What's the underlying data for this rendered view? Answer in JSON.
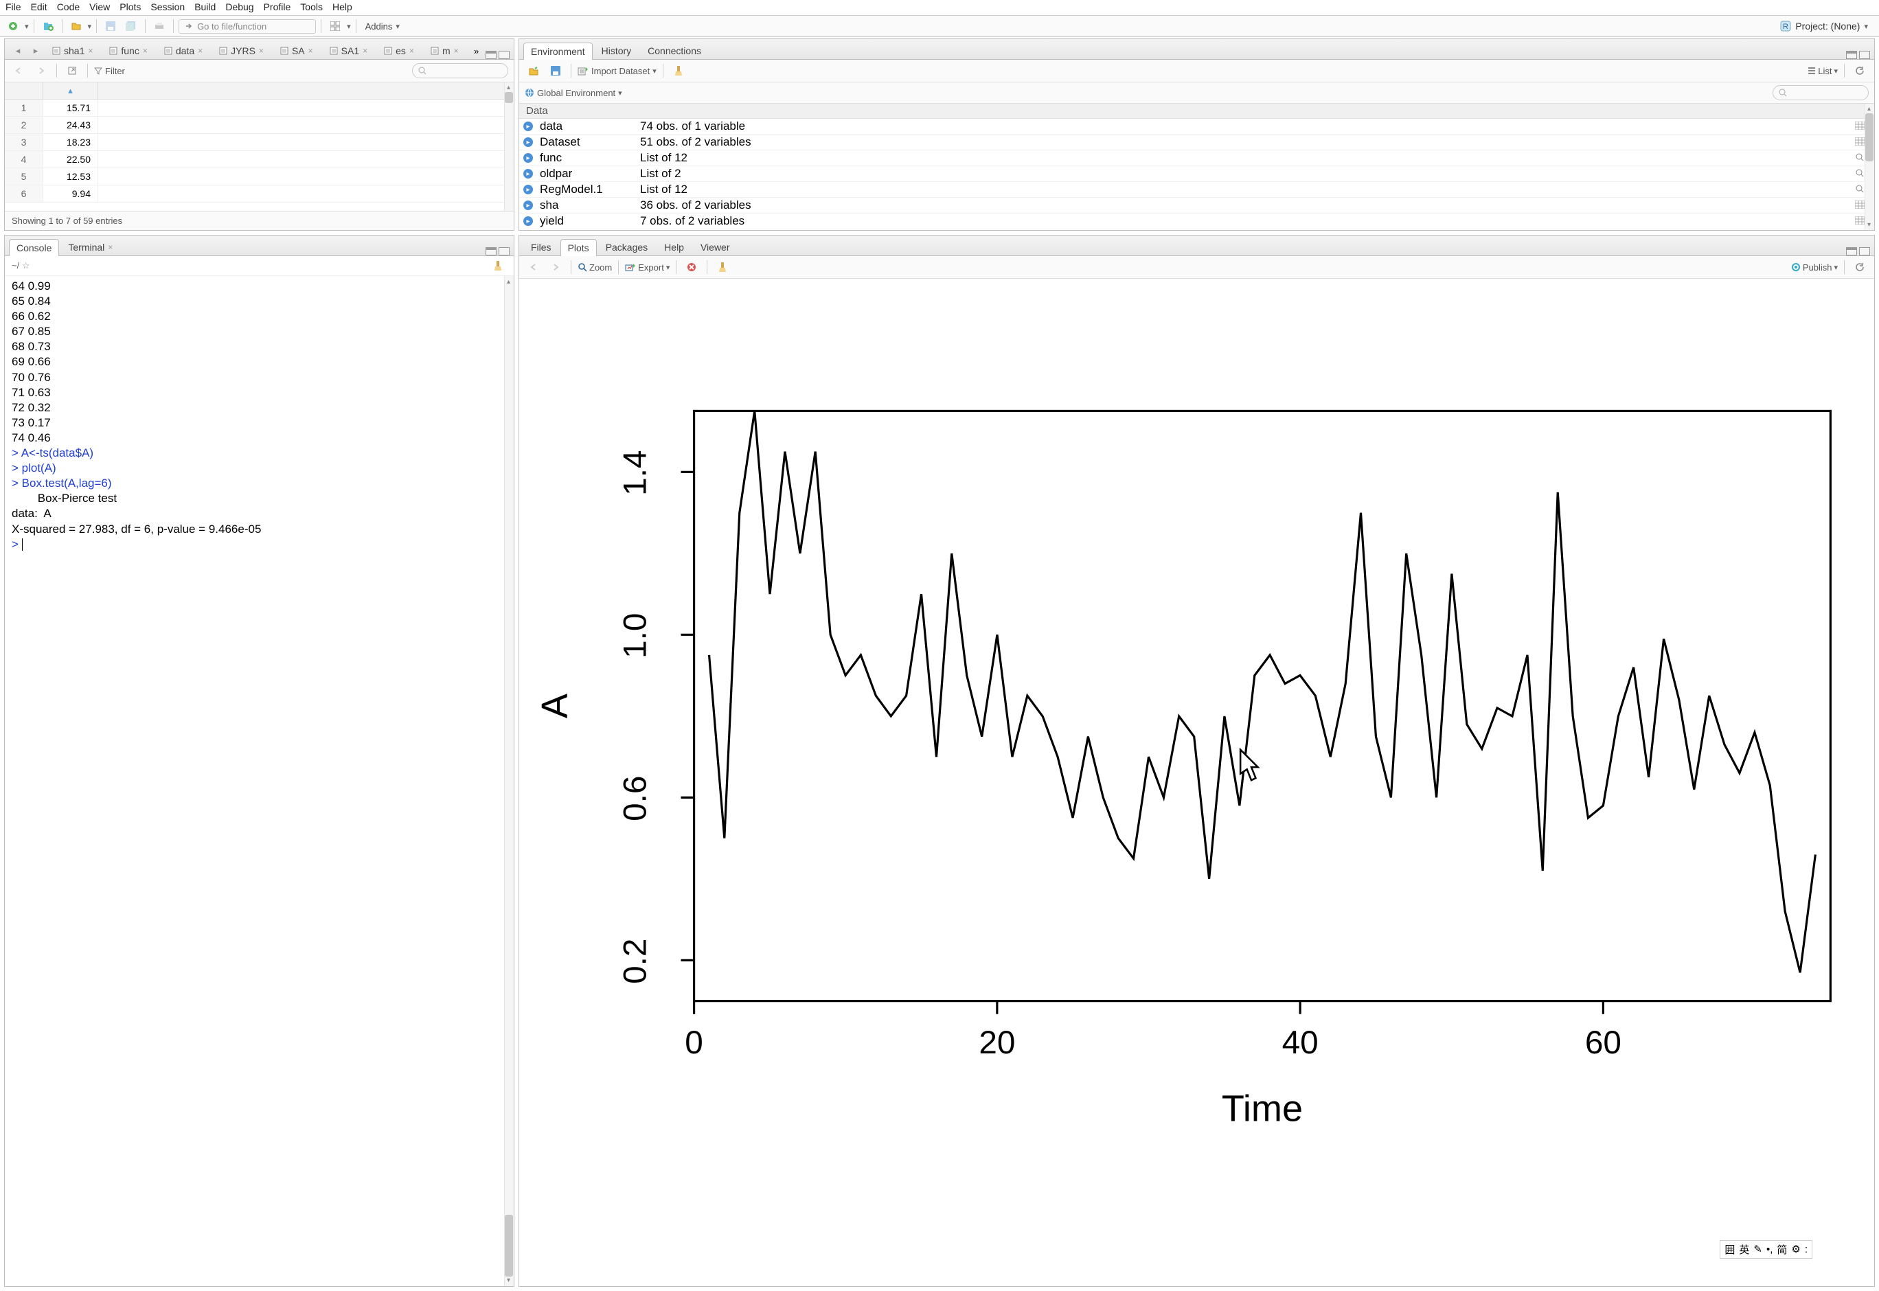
{
  "menu": [
    "File",
    "Edit",
    "Code",
    "View",
    "Plots",
    "Session",
    "Build",
    "Debug",
    "Profile",
    "Tools",
    "Help"
  ],
  "toolbar": {
    "goto_placeholder": "Go to file/function",
    "addins": "Addins"
  },
  "project": {
    "label": "Project: (None)"
  },
  "source": {
    "tabs": [
      "sha1",
      "func",
      "data",
      "JYRS",
      "SA",
      "SA1",
      "es",
      "m"
    ],
    "filter": "Filter",
    "rows": [
      {
        "i": "1",
        "v": "15.71"
      },
      {
        "i": "2",
        "v": "24.43"
      },
      {
        "i": "3",
        "v": "18.23"
      },
      {
        "i": "4",
        "v": "22.50"
      },
      {
        "i": "5",
        "v": "12.53"
      },
      {
        "i": "6",
        "v": "9.94"
      }
    ],
    "status": "Showing 1 to 7 of 59 entries"
  },
  "console": {
    "tab1": "Console",
    "tab2": "Terminal",
    "path": "~/",
    "lines": [
      {
        "t": "64 0.99",
        "c": false
      },
      {
        "t": "65 0.84",
        "c": false
      },
      {
        "t": "66 0.62",
        "c": false
      },
      {
        "t": "67 0.85",
        "c": false
      },
      {
        "t": "68 0.73",
        "c": false
      },
      {
        "t": "69 0.66",
        "c": false
      },
      {
        "t": "70 0.76",
        "c": false
      },
      {
        "t": "71 0.63",
        "c": false
      },
      {
        "t": "72 0.32",
        "c": false
      },
      {
        "t": "73 0.17",
        "c": false
      },
      {
        "t": "74 0.46",
        "c": false
      },
      {
        "t": "> A<-ts(data$A)",
        "c": true
      },
      {
        "t": "> plot(A)",
        "c": true
      },
      {
        "t": "> Box.test(A,lag=6)",
        "c": true
      },
      {
        "t": "",
        "c": false
      },
      {
        "t": "        Box-Pierce test",
        "c": false
      },
      {
        "t": "",
        "c": false
      },
      {
        "t": "data:  A",
        "c": false
      },
      {
        "t": "X-squared = 27.983, df = 6, p-value = 9.466e-05",
        "c": false
      },
      {
        "t": "",
        "c": false
      }
    ],
    "prompt": "> "
  },
  "env": {
    "tabs": [
      "Environment",
      "History",
      "Connections"
    ],
    "import": "Import Dataset",
    "listmode": "List",
    "scope": "Global Environment",
    "section": "Data",
    "items": [
      {
        "name": "data",
        "desc": "74 obs. of 1 variable",
        "icon": "grid"
      },
      {
        "name": "Dataset",
        "desc": "51 obs. of 2 variables",
        "icon": "grid"
      },
      {
        "name": "func",
        "desc": "List of 12",
        "icon": "search"
      },
      {
        "name": "oldpar",
        "desc": "List of 2",
        "icon": "search"
      },
      {
        "name": "RegModel.1",
        "desc": "List of 12",
        "icon": "search"
      },
      {
        "name": "sha",
        "desc": "36 obs. of 2 variables",
        "icon": "grid"
      },
      {
        "name": "yield",
        "desc": "7 obs. of 2 variables",
        "icon": "grid"
      }
    ]
  },
  "plots": {
    "tabs": [
      "Files",
      "Plots",
      "Packages",
      "Help",
      "Viewer"
    ],
    "zoom": "Zoom",
    "export": "Export",
    "publish": "Publish"
  },
  "chart_data": {
    "type": "line",
    "xlabel": "Time",
    "ylabel": "A",
    "x_ticks": [
      0,
      20,
      40,
      60
    ],
    "y_ticks": [
      0.2,
      0.6,
      1.0,
      1.4
    ],
    "xlim": [
      0,
      75
    ],
    "ylim": [
      0.1,
      1.55
    ],
    "series": [
      {
        "name": "A",
        "x": [
          1,
          2,
          3,
          4,
          5,
          6,
          7,
          8,
          9,
          10,
          11,
          12,
          13,
          14,
          15,
          16,
          17,
          18,
          19,
          20,
          21,
          22,
          23,
          24,
          25,
          26,
          27,
          28,
          29,
          30,
          31,
          32,
          33,
          34,
          35,
          36,
          37,
          38,
          39,
          40,
          41,
          42,
          43,
          44,
          45,
          46,
          47,
          48,
          49,
          50,
          51,
          52,
          53,
          54,
          55,
          56,
          57,
          58,
          59,
          60,
          61,
          62,
          63,
          64,
          65,
          66,
          67,
          68,
          69,
          70,
          71,
          72,
          73,
          74
        ],
        "y": [
          0.95,
          0.5,
          1.3,
          1.55,
          1.1,
          1.45,
          1.2,
          1.45,
          1.0,
          0.9,
          0.95,
          0.85,
          0.8,
          0.85,
          1.1,
          0.7,
          1.2,
          0.9,
          0.75,
          1.0,
          0.7,
          0.85,
          0.8,
          0.7,
          0.55,
          0.75,
          0.6,
          0.5,
          0.45,
          0.7,
          0.6,
          0.8,
          0.75,
          0.4,
          0.8,
          0.58,
          0.9,
          0.95,
          0.88,
          0.9,
          0.85,
          0.7,
          0.88,
          1.3,
          0.75,
          0.6,
          1.2,
          0.95,
          0.6,
          1.15,
          0.78,
          0.72,
          0.82,
          0.8,
          0.95,
          0.42,
          1.35,
          0.8,
          0.55,
          0.58,
          0.8,
          0.92,
          0.65,
          0.99,
          0.84,
          0.62,
          0.85,
          0.73,
          0.66,
          0.76,
          0.63,
          0.32,
          0.17,
          0.46
        ]
      }
    ]
  },
  "ime": [
    "囲",
    "英",
    "✎",
    "•,",
    "简",
    "⚙",
    ":"
  ]
}
